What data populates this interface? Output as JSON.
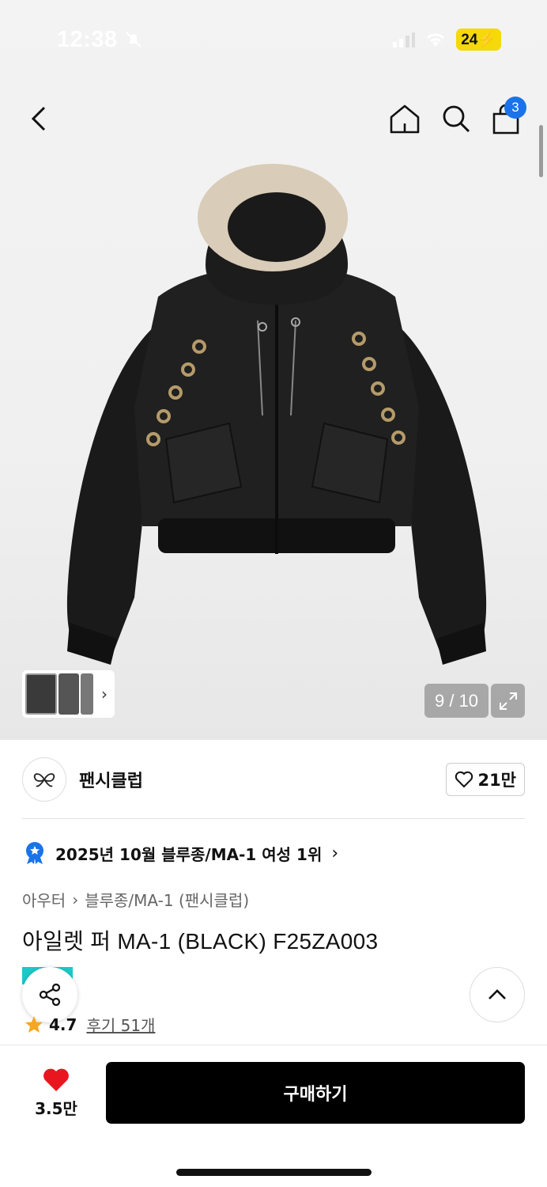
{
  "status_bar": {
    "time": "12:38",
    "battery": "24"
  },
  "nav": {
    "cart_count": "3"
  },
  "gallery": {
    "counter": "9 / 10",
    "image_alt": "Black MA-1 hooded bomber jacket with fur trim and eyelets"
  },
  "brand": {
    "name": "팬시클럽",
    "likes": "21만"
  },
  "ranking": {
    "text": "2025년 10월 블루종/MA-1 여성 1위"
  },
  "breadcrumb": {
    "category": "아우터",
    "subcategory": "블루종/MA-1 (팬시클럽)"
  },
  "product": {
    "title": "아일렛 퍼 MA-1 (BLACK) F25ZA003",
    "rating": "4.7",
    "reviews": "후기 51개"
  },
  "bottom_bar": {
    "wishlist_count": "3.5만",
    "buy_label": "구매하기"
  },
  "colors": {
    "accent_badge": "#1a73e8",
    "heart": "#e8171f",
    "rating_star": "#f5a623",
    "buy_button": "#000000"
  }
}
